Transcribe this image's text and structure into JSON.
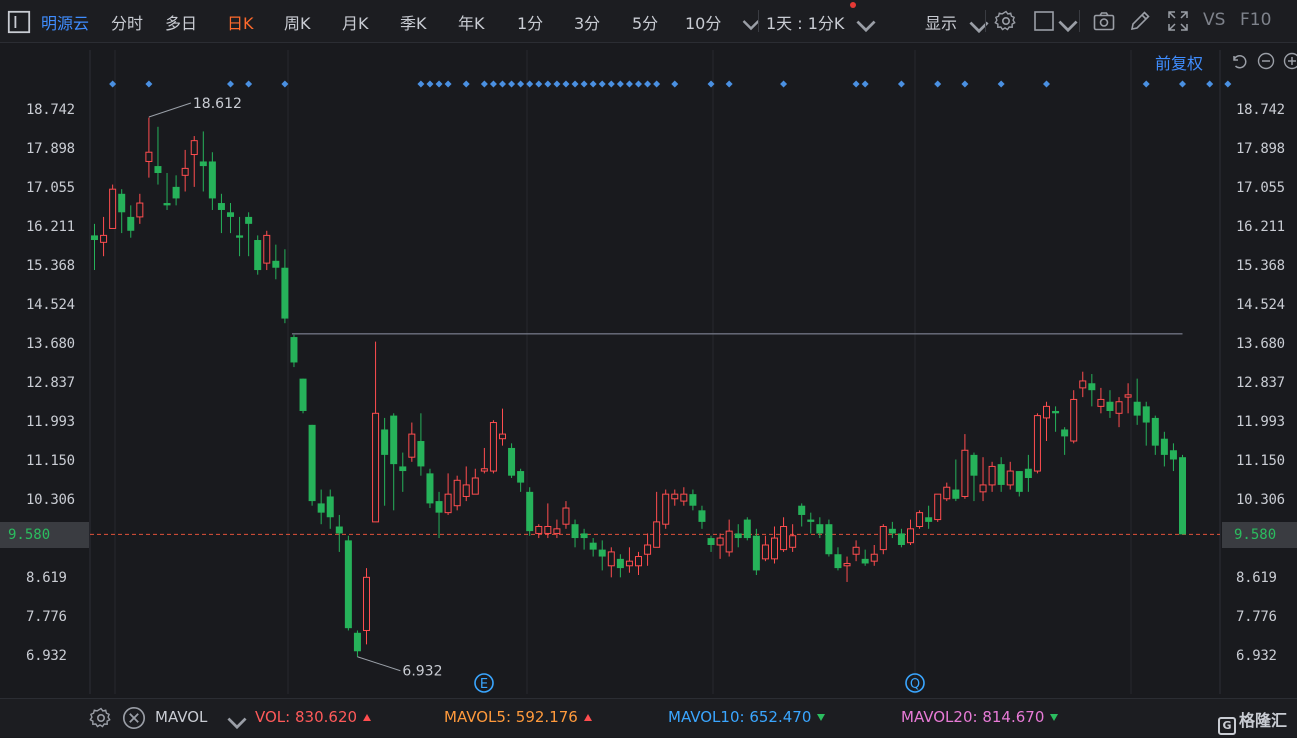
{
  "toolbar": {
    "stock_name": "明源云",
    "periods": [
      "分时",
      "多日",
      "日K",
      "周K",
      "月K",
      "季K",
      "年K",
      "1分",
      "3分",
      "5分",
      "10分"
    ],
    "active_period": "日K",
    "interval_select": "1天 : 1分K",
    "display_menu": "显示",
    "vs_label": "VS",
    "f10_label": "F10"
  },
  "adjust_label": "前复权",
  "price_axis": {
    "ticks": [
      "18.742",
      "17.898",
      "17.055",
      "16.211",
      "15.368",
      "14.524",
      "13.680",
      "12.837",
      "11.993",
      "11.150",
      "10.306",
      "9.580",
      "8.619",
      "7.776",
      "6.932"
    ],
    "current_price": "9.580"
  },
  "chart_data": {
    "type": "candlestick",
    "price_ticks": [
      18.742,
      17.898,
      17.055,
      16.211,
      15.368,
      14.524,
      13.68,
      12.837,
      11.993,
      11.15,
      10.306,
      8.619,
      7.776,
      6.932
    ],
    "y_range": [
      6.3,
      19.2
    ],
    "current_price": 9.58,
    "current_price_label": "9.580",
    "max_label": "18.612",
    "min_label": "6.932",
    "max_value": 18.612,
    "min_value": 6.932,
    "resistance_level": 13.92,
    "candles": [
      [
        16.05,
        15.95,
        16.3,
        15.3
      ],
      [
        15.9,
        16.05,
        16.45,
        15.6
      ],
      [
        16.2,
        17.05,
        17.15,
        16.2
      ],
      [
        16.95,
        16.55,
        17.05,
        16.1
      ],
      [
        16.45,
        16.15,
        16.7,
        16.0
      ],
      [
        16.45,
        16.75,
        16.95,
        16.3
      ],
      [
        17.65,
        17.85,
        18.6,
        17.3
      ],
      [
        17.55,
        17.4,
        18.4,
        17.15
      ],
      [
        16.75,
        16.7,
        17.4,
        16.6
      ],
      [
        17.1,
        16.85,
        17.35,
        16.7
      ],
      [
        17.35,
        17.5,
        17.9,
        17.0
      ],
      [
        17.8,
        18.1,
        18.2,
        17.1
      ],
      [
        17.65,
        17.55,
        18.3,
        17.0
      ],
      [
        17.65,
        16.85,
        17.85,
        16.6
      ],
      [
        16.75,
        16.6,
        16.95,
        16.1
      ],
      [
        16.55,
        16.45,
        16.75,
        16.1
      ],
      [
        16.05,
        16.0,
        16.45,
        15.6
      ],
      [
        16.45,
        16.3,
        16.55,
        15.6
      ],
      [
        15.95,
        15.3,
        16.05,
        15.2
      ],
      [
        15.45,
        16.05,
        16.15,
        15.3
      ],
      [
        15.5,
        15.35,
        15.85,
        15.1
      ],
      [
        15.35,
        14.25,
        15.75,
        14.15
      ],
      [
        13.85,
        13.3,
        13.9,
        13.2
      ],
      [
        12.95,
        12.25,
        12.95,
        12.2
      ],
      [
        11.95,
        10.3,
        11.95,
        10.2
      ],
      [
        10.25,
        10.05,
        10.55,
        9.8
      ],
      [
        10.4,
        9.95,
        10.55,
        9.7
      ],
      [
        9.75,
        9.6,
        10.0,
        9.2
      ],
      [
        9.45,
        7.55,
        9.55,
        7.5
      ],
      [
        7.45,
        7.05,
        7.5,
        6.93
      ],
      [
        7.5,
        8.65,
        8.85,
        7.2
      ],
      [
        9.85,
        12.2,
        13.75,
        9.85
      ],
      [
        11.85,
        11.3,
        12.1,
        10.2
      ],
      [
        12.15,
        11.1,
        12.2,
        10.1
      ],
      [
        11.05,
        10.95,
        11.35,
        10.5
      ],
      [
        11.25,
        11.75,
        12.0,
        11.15
      ],
      [
        11.6,
        11.05,
        12.2,
        10.85
      ],
      [
        10.9,
        10.25,
        11.0,
        10.15
      ],
      [
        10.3,
        10.05,
        10.5,
        9.5
      ],
      [
        10.05,
        10.45,
        10.9,
        10.0
      ],
      [
        10.2,
        10.75,
        10.85,
        10.1
      ],
      [
        10.4,
        10.65,
        11.05,
        10.3
      ],
      [
        10.45,
        10.8,
        11.0,
        10.45
      ],
      [
        10.95,
        11.0,
        11.45,
        10.9
      ],
      [
        10.95,
        12.0,
        12.05,
        10.9
      ],
      [
        11.65,
        11.75,
        12.3,
        11.5
      ],
      [
        11.45,
        10.85,
        11.55,
        10.8
      ],
      [
        10.95,
        10.7,
        11.0,
        10.5
      ],
      [
        10.5,
        9.65,
        10.6,
        9.55
      ],
      [
        9.6,
        9.75,
        9.8,
        9.5
      ],
      [
        9.6,
        9.75,
        10.25,
        9.5
      ],
      [
        9.6,
        9.7,
        9.9,
        9.5
      ],
      [
        9.8,
        10.15,
        10.3,
        9.7
      ],
      [
        9.8,
        9.5,
        9.9,
        9.3
      ],
      [
        9.6,
        9.5,
        9.7,
        9.25
      ],
      [
        9.4,
        9.25,
        9.5,
        9.1
      ],
      [
        9.25,
        9.1,
        9.45,
        8.8
      ],
      [
        8.9,
        9.2,
        9.3,
        8.65
      ],
      [
        9.05,
        8.85,
        9.15,
        8.65
      ],
      [
        8.9,
        9.0,
        9.3,
        8.75
      ],
      [
        8.9,
        9.1,
        9.2,
        8.7
      ],
      [
        9.15,
        9.35,
        9.6,
        8.9
      ],
      [
        9.3,
        9.85,
        10.5,
        9.3
      ],
      [
        9.8,
        10.45,
        10.55,
        9.7
      ],
      [
        10.35,
        10.45,
        10.55,
        10.2
      ],
      [
        10.3,
        10.45,
        10.6,
        10.2
      ],
      [
        10.45,
        10.2,
        10.55,
        10.1
      ],
      [
        10.1,
        9.85,
        10.2,
        9.7
      ],
      [
        9.5,
        9.35,
        9.55,
        9.2
      ],
      [
        9.35,
        9.5,
        9.6,
        9.05
      ],
      [
        9.2,
        9.65,
        9.9,
        9.1
      ],
      [
        9.6,
        9.5,
        9.8,
        9.3
      ],
      [
        9.9,
        9.5,
        9.95,
        9.45
      ],
      [
        9.55,
        8.8,
        9.7,
        8.7
      ],
      [
        9.05,
        9.35,
        9.55,
        9.0
      ],
      [
        9.05,
        9.5,
        9.75,
        8.95
      ],
      [
        9.25,
        9.75,
        9.95,
        9.2
      ],
      [
        9.3,
        9.55,
        9.8,
        9.2
      ],
      [
        10.2,
        10.0,
        10.25,
        9.75
      ],
      [
        9.9,
        9.85,
        10.05,
        9.6
      ],
      [
        9.8,
        9.6,
        9.95,
        9.5
      ],
      [
        9.8,
        9.15,
        9.9,
        9.1
      ],
      [
        9.15,
        8.85,
        9.3,
        8.8
      ],
      [
        8.9,
        8.95,
        9.1,
        8.55
      ],
      [
        9.15,
        9.3,
        9.45,
        9.0
      ],
      [
        9.05,
        8.95,
        9.25,
        8.9
      ],
      [
        9.0,
        9.15,
        9.35,
        8.9
      ],
      [
        9.25,
        9.75,
        9.8,
        9.15
      ],
      [
        9.7,
        9.6,
        9.85,
        9.5
      ],
      [
        9.6,
        9.35,
        9.7,
        9.3
      ],
      [
        9.4,
        9.7,
        9.9,
        9.35
      ],
      [
        9.75,
        10.05,
        10.1,
        9.7
      ],
      [
        9.95,
        9.85,
        10.2,
        9.7
      ],
      [
        9.9,
        10.45,
        10.45,
        9.85
      ],
      [
        10.35,
        10.6,
        10.7,
        10.3
      ],
      [
        10.55,
        10.35,
        11.2,
        10.3
      ],
      [
        10.4,
        11.4,
        11.75,
        10.35
      ],
      [
        11.3,
        10.85,
        11.35,
        10.3
      ],
      [
        10.5,
        10.65,
        11.25,
        10.3
      ],
      [
        10.65,
        11.05,
        11.15,
        10.5
      ],
      [
        11.1,
        10.65,
        11.25,
        10.5
      ],
      [
        10.65,
        10.95,
        11.15,
        10.55
      ],
      [
        10.95,
        10.5,
        10.95,
        10.4
      ],
      [
        11.0,
        10.8,
        11.3,
        10.5
      ],
      [
        10.95,
        12.15,
        12.2,
        10.9
      ],
      [
        12.1,
        12.35,
        12.45,
        11.6
      ],
      [
        12.25,
        12.2,
        12.35,
        11.8
      ],
      [
        11.85,
        11.7,
        11.9,
        11.3
      ],
      [
        11.6,
        12.5,
        12.7,
        11.55
      ],
      [
        12.75,
        12.9,
        13.1,
        12.55
      ],
      [
        12.85,
        12.7,
        13.05,
        12.35
      ],
      [
        12.35,
        12.5,
        12.75,
        12.2
      ],
      [
        12.45,
        12.25,
        12.7,
        12.1
      ],
      [
        12.2,
        12.45,
        12.55,
        11.9
      ],
      [
        12.55,
        12.6,
        12.85,
        12.2
      ],
      [
        12.45,
        12.15,
        12.95,
        11.95
      ],
      [
        12.35,
        12.0,
        12.45,
        11.5
      ],
      [
        12.1,
        11.5,
        12.15,
        11.3
      ],
      [
        11.65,
        11.3,
        11.8,
        11.05
      ],
      [
        11.4,
        11.2,
        11.55,
        10.95
      ],
      [
        11.25,
        9.58,
        11.3,
        9.58
      ]
    ],
    "candle_marker_indices": [
      2,
      6,
      15,
      17,
      21,
      36,
      37,
      38,
      39,
      41,
      43,
      44,
      45,
      46,
      47,
      48,
      49,
      50,
      51,
      52,
      53,
      54,
      55,
      56,
      57,
      58,
      59,
      60,
      61,
      62,
      64,
      68,
      70,
      76,
      84,
      85,
      89,
      93,
      96,
      100,
      105,
      116,
      120,
      123,
      125
    ],
    "event_badges": [
      "E",
      "Q"
    ],
    "colors": {
      "up": "#ff4d4f",
      "down": "#26b25a",
      "marker": "#4a90e2",
      "current_line": "#e0523a",
      "resistance": "#6e7280"
    }
  },
  "indicators": {
    "name": "MAVOL",
    "vol_label": "VOL:",
    "vol_value": "830.620",
    "mavol5_label": "MAVOL5:",
    "mavol5_value": "592.176",
    "mavol10_label": "MAVOL10:",
    "mavol10_value": "652.470",
    "mavol20_label": "MAVOL20:",
    "mavol20_value": "814.670",
    "colors": {
      "vol": "#ff5a5a",
      "mavol5": "#ff9a3c",
      "mavol10": "#3aa6ff",
      "mavol20": "#e87bd7"
    }
  },
  "watermark": "格隆汇"
}
